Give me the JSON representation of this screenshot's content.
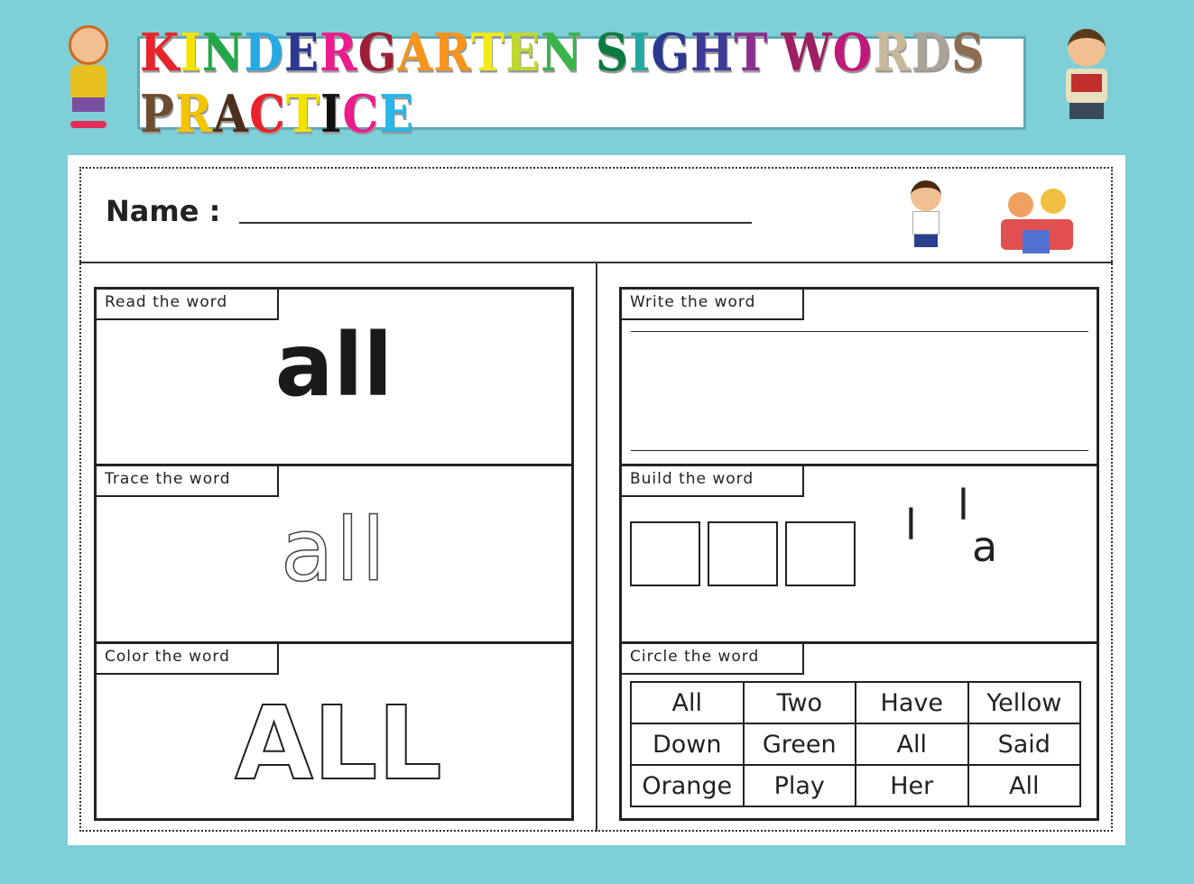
{
  "title": {
    "letters": [
      [
        "K",
        "#e8232a"
      ],
      [
        "I",
        "#f2e300"
      ],
      [
        "N",
        "#22a84a"
      ],
      [
        "D",
        "#27a9e1"
      ],
      [
        "E",
        "#2b3990"
      ],
      [
        "R",
        "#ec1c8c"
      ],
      [
        "G",
        "#9e1f35"
      ],
      [
        "A",
        "#f7941d"
      ],
      [
        "R",
        "#f7941d"
      ],
      [
        "T",
        "#f4ea1a"
      ],
      [
        "E",
        "#bfd730"
      ],
      [
        "N",
        "#3ab54a"
      ],
      [
        " ",
        ""
      ],
      [
        "S",
        "#0b7a3e"
      ],
      [
        "I",
        "#1fa9a0"
      ],
      [
        "G",
        "#2b3990"
      ],
      [
        "H",
        "#3d3b98"
      ],
      [
        "T",
        "#8b2f8f"
      ],
      [
        " ",
        ""
      ],
      [
        "W",
        "#9e1f63"
      ],
      [
        "O",
        "#c0197a"
      ],
      [
        "R",
        "#c8b89a"
      ],
      [
        "D",
        "#aaa39a"
      ],
      [
        "S",
        "#8c6d52"
      ],
      [
        " ",
        ""
      ],
      [
        "P",
        "#6d4c2f"
      ],
      [
        "R",
        "#f2c500"
      ],
      [
        "A",
        "#4b2e1b"
      ],
      [
        "C",
        "#e8232a"
      ],
      [
        "T",
        "#f2e300"
      ],
      [
        "I",
        "#111111"
      ],
      [
        "C",
        "#ec1c8c"
      ],
      [
        "E",
        "#29b6e8"
      ]
    ],
    "text": "KINDERGARTEN SIGHT WORDS PRACTICE"
  },
  "name_label": "Name :",
  "sections": {
    "read": "Read the word",
    "trace": "Trace the word",
    "color": "Color the word",
    "write": "Write the word",
    "build": "Build the word",
    "circle": "Circle the word"
  },
  "word": "all",
  "color_word": "ALL",
  "build_letters": [
    "l",
    "l",
    "a"
  ],
  "circle_words": [
    "All",
    "Two",
    "Have",
    "Yellow",
    "Down",
    "Green",
    "All",
    "Said",
    "Orange",
    "Play",
    "Her",
    "All"
  ],
  "colors": {
    "background": "#7ecfd8",
    "title_border": "#5fa9b3"
  }
}
